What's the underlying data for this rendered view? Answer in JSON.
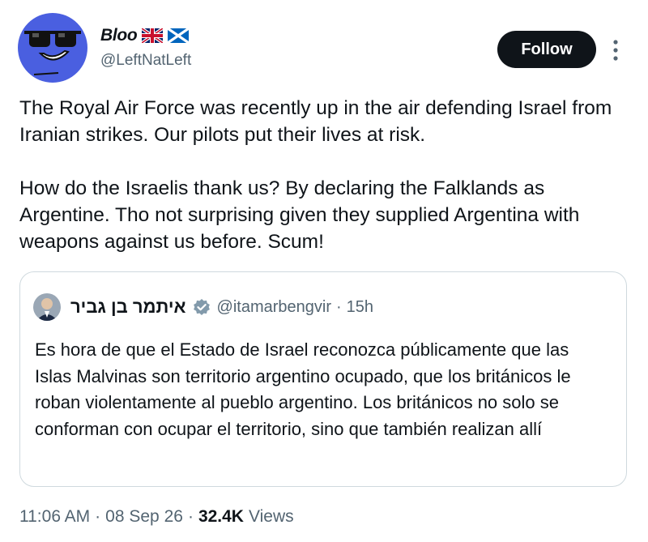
{
  "author": {
    "display_name": "Bloo",
    "handle": "@LeftNatLeft",
    "flags": [
      "uk-flag-icon",
      "scotland-flag-icon"
    ]
  },
  "actions": {
    "follow_label": "Follow",
    "more_icon": "more-vertical-icon"
  },
  "tweet": {
    "paragraphs": [
      "The Royal Air Force was recently up in the air defending Israel from Iranian strikes. Our pilots put their lives at risk.",
      "How do the Israelis thank us? By declaring the Falklands as Argentine. Tho not surprising given they supplied Argentina with weapons against us before. Scum!"
    ]
  },
  "quote": {
    "display_name": "איתמר בן גביר",
    "handle": "@itamarbengvir",
    "separator": "·",
    "time": "15h",
    "verified_icon": "verified-badge-icon",
    "text": "Es hora de que el Estado de Israel reconozca públicamente que las Islas Malvinas son territorio argentino ocupado, que los británicos le roban violentamente al pueblo argentino. Los británicos no solo se conforman con ocupar el territorio, sino que también realizan allí"
  },
  "meta": {
    "time": "11:06 AM",
    "date": "08 Sep 26",
    "separator": "·",
    "views_count": "32.4K",
    "views_label": "Views"
  },
  "colors": {
    "text_primary": "#0f1419",
    "text_secondary": "#536471",
    "border": "#cfd9de",
    "follow_bg": "#0f1419",
    "verified": "#829aab",
    "avatar_blue": "#4a5fe0"
  }
}
